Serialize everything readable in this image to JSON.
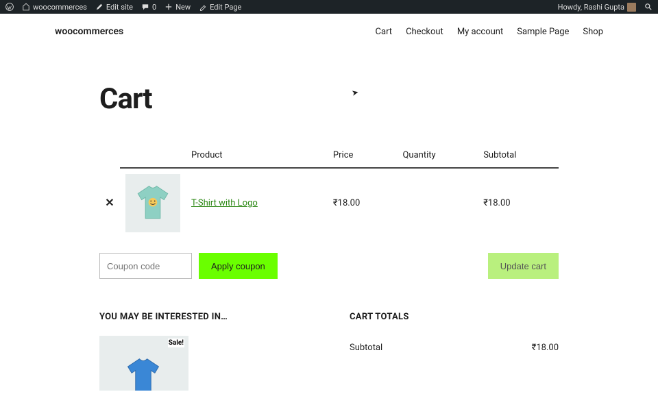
{
  "admin": {
    "site_name": "woocommerces",
    "edit_site": "Edit site",
    "comments": "0",
    "new": "New",
    "edit_page": "Edit Page",
    "howdy": "Howdy, Rashi Gupta"
  },
  "header": {
    "title": "woocommerces",
    "nav": {
      "cart": "Cart",
      "checkout": "Checkout",
      "account": "My account",
      "sample": "Sample Page",
      "shop": "Shop"
    }
  },
  "page": {
    "title": "Cart"
  },
  "table": {
    "headers": {
      "product": "Product",
      "price": "Price",
      "quantity": "Quantity",
      "subtotal": "Subtotal"
    },
    "rows": [
      {
        "name": "T-Shirt with Logo",
        "price": "₹18.00",
        "qty": "",
        "subtotal": "₹18.00"
      }
    ]
  },
  "actions": {
    "coupon_placeholder": "Coupon code",
    "apply": "Apply coupon",
    "update": "Update cart"
  },
  "interest": {
    "heading": "YOU MAY BE INTERESTED IN…",
    "sale": "Sale!"
  },
  "totals": {
    "heading": "CART TOTALS",
    "subtotal_label": "Subtotal",
    "subtotal_value": "₹18.00"
  }
}
